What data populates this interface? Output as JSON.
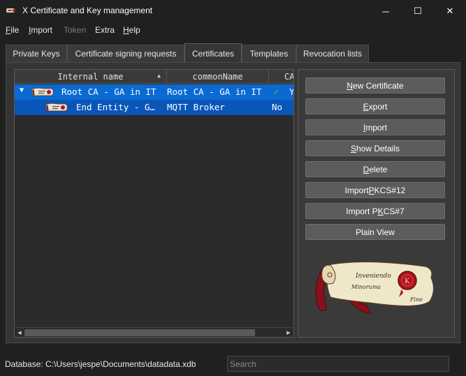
{
  "window": {
    "title": "X Certificate and Key management",
    "minimize_glyph": "─",
    "maximize_glyph": "☐",
    "close_glyph": "✕"
  },
  "menu": [
    {
      "label": "File",
      "accel": "F",
      "rest": "ile",
      "enabled": true
    },
    {
      "label": "Import",
      "accel": "I",
      "rest": "mport",
      "enabled": true
    },
    {
      "label": "Token",
      "enabled": false
    },
    {
      "label": "Extra",
      "accel": "",
      "rest": "Extra",
      "enabled": true
    },
    {
      "label": "Help",
      "accel": "H",
      "rest": "elp",
      "enabled": true
    }
  ],
  "tabs": [
    {
      "label": "Private Keys",
      "active": false
    },
    {
      "label": "Certificate signing requests",
      "active": false
    },
    {
      "label": "Certificates",
      "active": true
    },
    {
      "label": "Templates",
      "active": false
    },
    {
      "label": "Revocation lists",
      "active": false
    }
  ],
  "tree": {
    "columns": [
      "Internal name",
      "commonName",
      "CA"
    ],
    "sort_indicator": "▲",
    "rows": [
      {
        "expander": "▼",
        "internal_name": "Root CA - GA in IT",
        "common_name": "Root CA - GA in IT",
        "ca": "✓",
        "ca_extra": "Y",
        "icon": "certificate-icon"
      },
      {
        "internal_name": "End Entity - G…",
        "common_name": "MQTT Broker",
        "ca": "No",
        "icon": "certificate-icon"
      }
    ],
    "scroll_left": "◀",
    "scroll_right": "▶"
  },
  "buttons": [
    {
      "label": "New Certificate",
      "accel": "N",
      "before": "",
      "after": "ew Certificate"
    },
    {
      "label": "Export",
      "accel": "E",
      "before": "",
      "after": "xport"
    },
    {
      "label": "Import",
      "accel": "I",
      "before": "",
      "after": "mport"
    },
    {
      "label": "Show Details",
      "accel": "S",
      "before": "",
      "after": "how Details"
    },
    {
      "label": "Delete",
      "accel": "D",
      "before": "",
      "after": "elete"
    },
    {
      "label": "Import PKCS#12",
      "accel": "P",
      "before": "Import ",
      "after": "KCS#12"
    },
    {
      "label": "Import PKCS#7",
      "accel": "K",
      "before": "Import P",
      "after": "CS#7"
    },
    {
      "label": "Plain View",
      "accel": "",
      "before": "Plain View",
      "after": ""
    }
  ],
  "artwork": {
    "line1": "Inveniendo",
    "line2": "Minoruma",
    "line3": "Fine",
    "seal_text": "K"
  },
  "status": {
    "database_label": "Database: C:\\Users\\jespe\\Documents\\datadata.xdb",
    "search_placeholder": "Search"
  },
  "colors": {
    "selection_primary": "#0a6ad2",
    "selection_secondary": "#0a55b8",
    "check_green": "#3fc33f",
    "seal_red": "#b0121b"
  }
}
